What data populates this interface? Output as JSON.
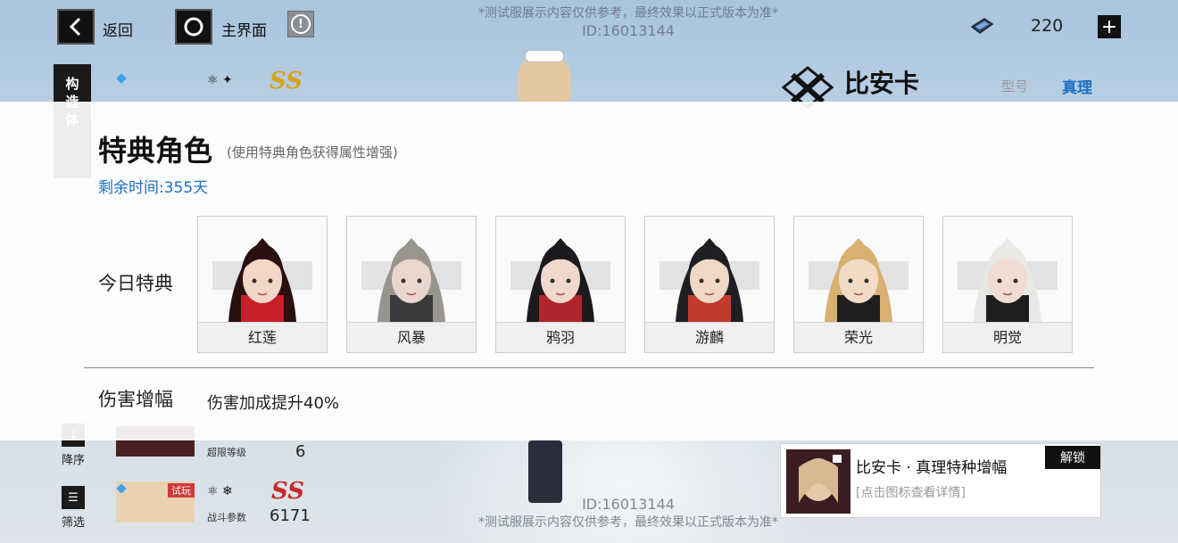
{
  "topbar": {
    "back_label": "返回",
    "home_label": "主界面",
    "info_symbol": "!",
    "currency_value": "220",
    "plus_symbol": "+"
  },
  "watermark": {
    "disclaimer": "*测试服展示内容仅供参考，最终效果以正式版本为准*",
    "id": "ID:16013144"
  },
  "side": {
    "construct_tab": "构造体",
    "sort_label": "降序",
    "filter_label": "筛选"
  },
  "roster": {
    "rank_top": "SS",
    "rank_bottom": "SS",
    "trial_tag": "试玩",
    "overlimit_label": "超限等级",
    "overlimit_value": "6",
    "combat_label": "战斗参数",
    "combat_value": "6171"
  },
  "header": {
    "character_name": "比安卡",
    "model_label": "型号",
    "model_value": "真理"
  },
  "panel": {
    "title": "特典角色",
    "subtitle": "(使用特典角色获得属性增强)",
    "remaining": "剩余时间:355天",
    "today_label": "今日特典",
    "cards": [
      {
        "name": "红莲",
        "hair": "#2a1010",
        "accent": "#c8202a",
        "skin": "#f2d6c8"
      },
      {
        "name": "风暴",
        "hair": "#9a948f",
        "accent": "#3a3a3a",
        "skin": "#ead6cc"
      },
      {
        "name": "鸦羽",
        "hair": "#1c1a1e",
        "accent": "#b0242c",
        "skin": "#f0d8cc"
      },
      {
        "name": "游麟",
        "hair": "#1e1f24",
        "accent": "#c23a2e",
        "skin": "#efd8c6"
      },
      {
        "name": "荣光",
        "hair": "#d8b070",
        "accent": "#1e1e1e",
        "skin": "#f2dcc6"
      },
      {
        "name": "明觉",
        "hair": "#e8e8e4",
        "accent": "#1e1e1e",
        "skin": "#f0dcd2"
      }
    ],
    "damage_label": "伤害增幅",
    "damage_value": "伤害加成提升40%"
  },
  "unlock": {
    "title": "比安卡 · 真理特种增幅",
    "hint": "[点击图标查看详情]",
    "button": "解锁"
  },
  "colors": {
    "accent_blue": "#1e70c6",
    "rank_red": "#c92a2a",
    "rank_gold": "#d6a316"
  }
}
